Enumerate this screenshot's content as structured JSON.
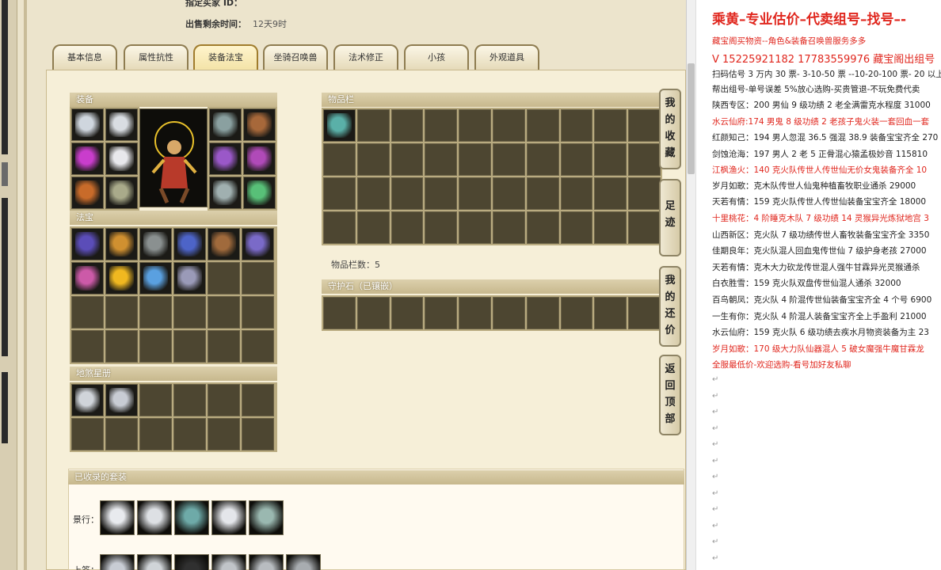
{
  "seller": {
    "buyer_id_label": "指定买家 ID：",
    "remaining_label": "出售剩余时间：",
    "remaining_value": "12天9时"
  },
  "tabs": [
    "基本信息",
    "属性抗性",
    "装备法宝",
    "坐骑召唤兽",
    "法术修正",
    "小孩",
    "外观道具"
  ],
  "active_tab": 2,
  "panels": {
    "equipment_title": "装备",
    "treasure_title": "法宝",
    "star_title": "地煞星册",
    "items_title": "物品栏",
    "items_count_label": "物品栏数：5",
    "guard_title": "守护石（已镶嵌）",
    "sets_title": "已收录的套装",
    "set_row1_label": "景行：",
    "set_row2_label": "上筌："
  },
  "side_buttons": [
    "我的收藏",
    "足迹",
    "我的还价",
    "返回顶部"
  ],
  "icon_colors": {
    "equip": [
      "#cfd6de",
      "#d9dde2",
      "#8aa0a0",
      "#a7683a",
      "#c93dcc",
      "#e8e8ec",
      "#9a58c8",
      "#b04ab8",
      "#c86b2a",
      "#a9aa8a",
      "#a0b0b0",
      "#58c078"
    ],
    "treasure": [
      "#5b4db8",
      "#d09030",
      "#8a9090",
      "#4d64c8",
      "#a06a3c",
      "#7a6ac8",
      "#cc5aa8",
      "#f0b820",
      "#5aa0e0",
      "#9a9ab8"
    ],
    "star": [
      "#d0d4da",
      "#c8ccd4"
    ],
    "items": [
      "#5ab0a8"
    ],
    "sets_row1": [
      "#e8eaee",
      "#dde0e4",
      "#6eaaa8",
      "#e4e6ea",
      "#9ab8b0"
    ],
    "sets_row2": [
      "#c8ccd4",
      "#d0d4d8",
      "#303030",
      "#c0c4c8",
      "#b8bcc0",
      "#a8acb0"
    ]
  },
  "notes": {
    "title": "乘黄–专业估价–代卖组号–找号–-",
    "lines": [
      {
        "text": "藏宝阁买物资--角色&装备召唤兽服务多多",
        "red": true
      },
      {
        "text": "V 15225921182  17783559976 藏宝阁出组号",
        "red": true,
        "big": true
      },
      {
        "text": "扫码估号 3 万内 30 票- 3-10-50 票 --10-20-100 票- 20 以上",
        "red": false
      },
      {
        "text": "帮出组号-单号误差 5%放心选购-买贵管退-不玩免费代卖",
        "red": false
      },
      {
        "text": "陕西专区：200 男仙 9 级功绩 2 老全满雷克水程度 31000",
        "red": false
      },
      {
        "text": "水云仙府:174 男鬼 8 级功绩 2 老孩子鬼火装一套回血一套",
        "red": true
      },
      {
        "text": "红颜知己：194 男人忽混 36.5 强混 38.9 装备宝宝齐全 270",
        "red": false
      },
      {
        "text": "剑蚀沧海：197 男人 2 老 5 正骨混心猿孟极妙音 115810",
        "red": false
      },
      {
        "text": "江枫渔火：140 克火队传世人传世仙无价女鬼装备齐全 10",
        "red": true
      },
      {
        "text": "岁月如歌：克木队传世人仙鬼种植畜牧职业通杀 29000",
        "red": false
      },
      {
        "text": "天若有情：159 克火队传世人传世仙装备宝宝齐全 18000",
        "red": false
      },
      {
        "text": "十里桃花：4 阶睡克木队 7 级功绩 14 灵猴异光炼狱地宫 3",
        "red": true
      },
      {
        "text": "山西新区：克火队 7 级功绩传世人畜牧装备宝宝齐全 3350",
        "red": false
      },
      {
        "text": "佳期良年：克火队混人回血鬼传世仙 7 级护身老孩 27000",
        "red": false
      },
      {
        "text": "天若有情：克木大力砍龙传世混人强牛甘霖异光灵猴通杀",
        "red": false
      },
      {
        "text": "白衣胜雪：159 克火队双盘传世仙混人通杀 32000",
        "red": false
      },
      {
        "text": "百鸟朝凤：克火队 4 阶混传世仙装备宝宝齐全 4 个号 6900",
        "red": false
      },
      {
        "text": "一生有你：克火队 4 阶混人装备宝宝齐全上手盈利 21000",
        "red": false
      },
      {
        "text": "水云仙府：159 克火队 6 级功绩去疾水月物资装备为主 23",
        "red": false
      },
      {
        "text": "岁月如歌：170 级大力队仙器混人 5 破女魔强牛魔甘霖龙",
        "red": true
      },
      {
        "text": "全服最低价-欢迎选购-看号加好友私聊",
        "red": true
      }
    ],
    "para_mark": "↵"
  }
}
